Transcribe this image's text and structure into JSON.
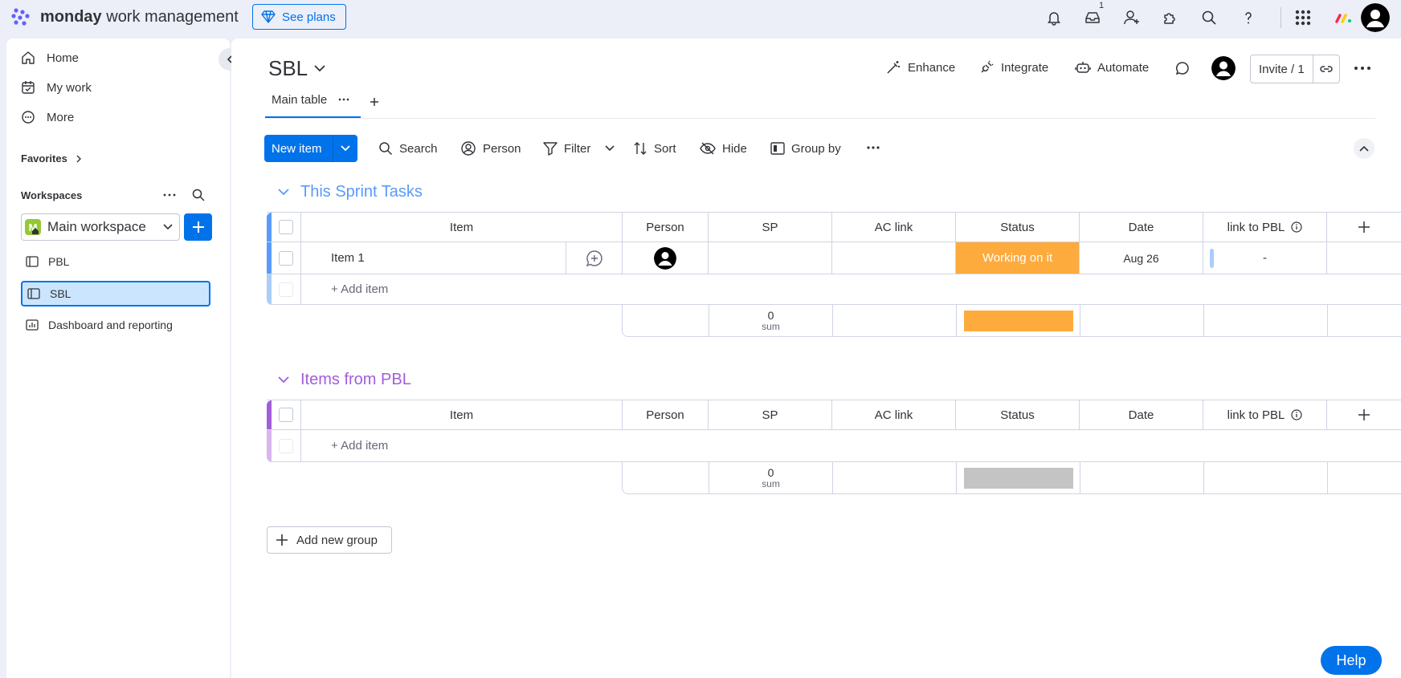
{
  "topbar": {
    "brand_bold": "monday",
    "brand_rest": " work management",
    "see_plans": "See plans",
    "inbox_badge": "1"
  },
  "sidebar": {
    "nav": [
      {
        "label": "Home",
        "icon": "home-icon"
      },
      {
        "label": "My work",
        "icon": "calendar-check-icon"
      },
      {
        "label": "More",
        "icon": "more-circle-icon"
      }
    ],
    "favorites_label": "Favorites",
    "workspaces_label": "Workspaces",
    "workspace_name": "Main workspace",
    "workspace_initial": "M",
    "boards": [
      {
        "label": "PBL",
        "icon": "board-icon"
      },
      {
        "label": "SBL",
        "icon": "board-icon",
        "active": true
      },
      {
        "label": "Dashboard and reporting",
        "icon": "dashboard-icon"
      }
    ]
  },
  "board": {
    "title": "SBL",
    "actions": {
      "enhance": "Enhance",
      "integrate": "Integrate",
      "automate": "Automate",
      "invite": "Invite / 1"
    },
    "tabs": [
      {
        "label": "Main table"
      }
    ],
    "toolbar": {
      "new_item": "New item",
      "search": "Search",
      "person": "Person",
      "filter": "Filter",
      "sort": "Sort",
      "hide": "Hide",
      "group_by": "Group by"
    },
    "columns": [
      "Item",
      "Person",
      "SP",
      "AC link",
      "Status",
      "Date",
      "link to PBL"
    ],
    "groups": [
      {
        "title": "This Sprint Tasks",
        "color": "#579bfc",
        "rows": [
          {
            "item": "Item 1",
            "status": "Working on it",
            "status_color": "#fdab3d",
            "date": "Aug 26",
            "link": "-"
          }
        ],
        "add_item": "+ Add item",
        "sp_sum": "0",
        "sum_label": "sum",
        "summary_bar_color": "#fdab3d"
      },
      {
        "title": "Items from PBL",
        "color": "#a25ddc",
        "rows": [],
        "add_item": "+ Add item",
        "sp_sum": "0",
        "sum_label": "sum",
        "summary_bar_color": "#c4c4c4"
      }
    ],
    "add_group": "Add new group"
  },
  "help": "Help"
}
